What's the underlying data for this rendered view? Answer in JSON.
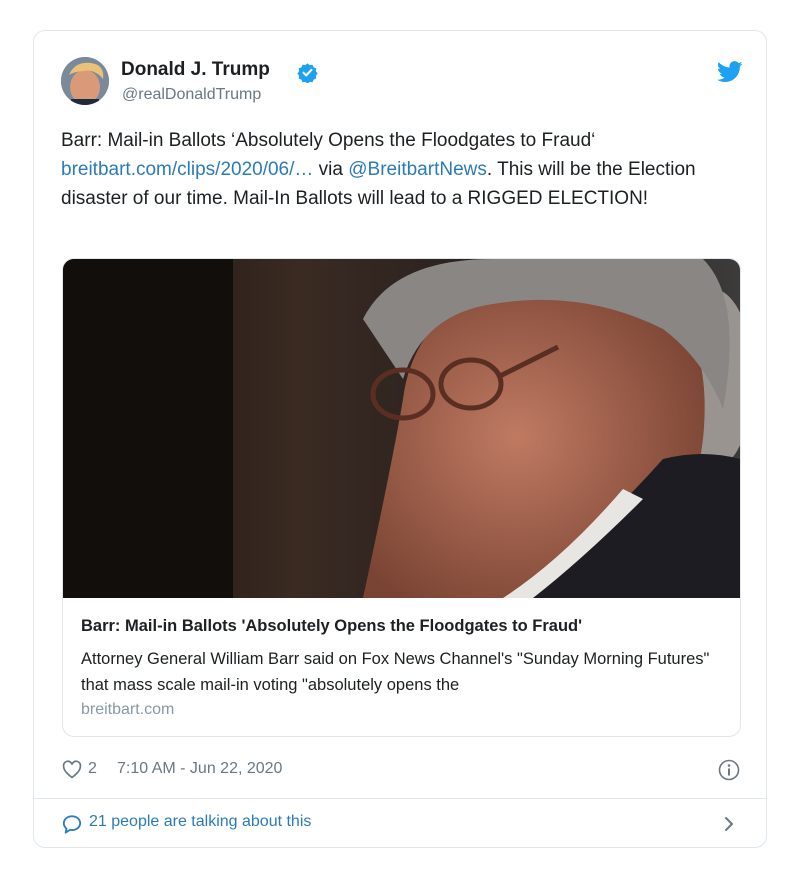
{
  "author": {
    "name": "Donald J. Trump",
    "handle": "@realDonaldTrump",
    "verified": true,
    "avatar_icon": "profile-photo"
  },
  "tweet": {
    "text_part1": "Barr: Mail-in Ballots ‘Absolutely Opens the Floodgates to Fraud‘",
    "link_text": "breitbart.com/clips/2020/06/…",
    "via_text": " via ",
    "mention": "@BreitbartNews",
    "text_part2": ". This will be the Election disaster of our time. Mail-In Ballots will lead to a RIGGED ELECTION!"
  },
  "link_card": {
    "title": "Barr: Mail-in Ballots 'Absolutely Opens the Floodgates to Fraud'",
    "description": "Attorney General William Barr said on Fox News Channel's \"Sunday Morning Futures\" that mass scale mail-in voting \"absolutely opens the",
    "domain": "breitbart.com"
  },
  "meta": {
    "like_count": "2",
    "timestamp": "7:10 AM - Jun 22, 2020"
  },
  "conversation": {
    "label": "21 people are talking about this"
  },
  "icons": {
    "verified": "verified-badge-icon",
    "brand": "twitter-bird-icon",
    "like": "heart-icon",
    "info": "info-icon",
    "reply": "speech-bubble-icon",
    "chevron": "chevron-right-icon"
  },
  "colors": {
    "link": "#2b7bb9",
    "verified": "#1da1f2",
    "text": "#1c2022",
    "secondary": "#697882",
    "border": "#e1e8ed"
  }
}
